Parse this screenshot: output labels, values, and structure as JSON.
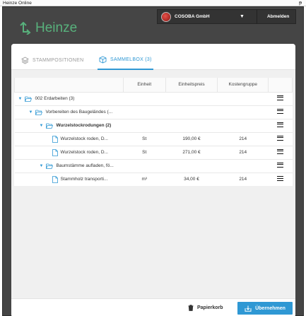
{
  "window": {
    "title": "Heinze Online",
    "pin_glyph": "ᵽ"
  },
  "brand": {
    "name": "Heinze",
    "logo_icon": "heinze-arrows-icon",
    "color": "#58b17c"
  },
  "user": {
    "company": "COSOBA GmbH",
    "logout_label": "Abmelden",
    "avatar_icon": "company-avatar-icon"
  },
  "tabs": [
    {
      "label": "STAMMPOSITIONEN",
      "icon": "layers-icon",
      "active": false
    },
    {
      "label": "SAMMELBOX (3)",
      "icon": "box-icon",
      "active": true
    }
  ],
  "table": {
    "headers": [
      "",
      "Einheit",
      "Einheitspreis",
      "Kostengruppe",
      ""
    ],
    "rows": [
      {
        "label": "002 Erdarbeiten (3)",
        "type": "folder",
        "level": 0,
        "bold": false,
        "einheit": "",
        "preis": "",
        "kg": ""
      },
      {
        "label": "Vorbereiten des Baugeländes (...",
        "type": "folder",
        "level": 1,
        "bold": false,
        "einheit": "",
        "preis": "",
        "kg": ""
      },
      {
        "label": "Wurzelstockrodungen (2)",
        "type": "folder",
        "level": 2,
        "bold": true,
        "einheit": "",
        "preis": "",
        "kg": ""
      },
      {
        "label": "Wurzelstock roden, D...",
        "type": "file",
        "level": 3,
        "bold": false,
        "einheit": "St",
        "preis": "190,00 €",
        "kg": "214"
      },
      {
        "label": "Wurzelstock roden, D...",
        "type": "file",
        "level": 3,
        "bold": false,
        "einheit": "St",
        "preis": "271,00 €",
        "kg": "214"
      },
      {
        "label": "Baumstämme aufladen, fö...",
        "type": "folder",
        "level": 2,
        "bold": false,
        "einheit": "",
        "preis": "",
        "kg": ""
      },
      {
        "label": "Stammholz transporti...",
        "type": "file",
        "level": 3,
        "bold": false,
        "einheit": "m³",
        "preis": "34,00 €",
        "kg": "214"
      }
    ]
  },
  "footer": {
    "trash_label": "Papierkorb",
    "apply_label": "Übernehmen"
  },
  "colors": {
    "accent": "#2f98d4",
    "app_bg": "#454545",
    "brand_green": "#58b17c"
  }
}
